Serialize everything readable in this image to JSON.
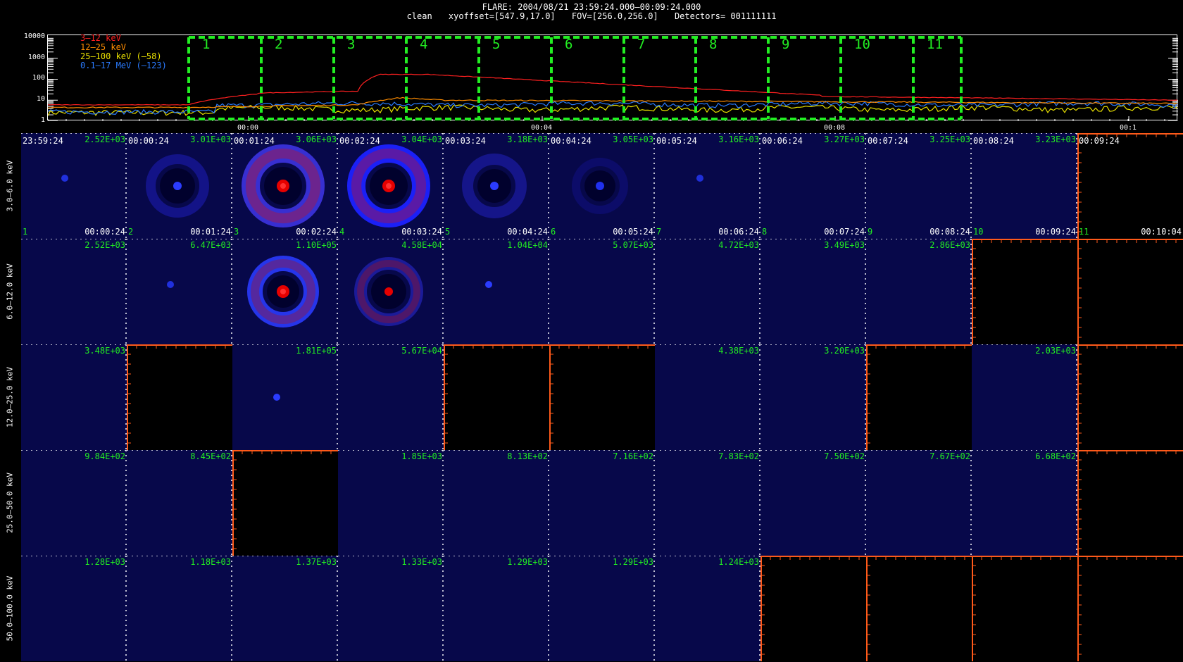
{
  "header": {
    "title": "FLARE: 2004/08/21 23:59:24.000—00:09:24.000",
    "mode": "clean",
    "xyoffset": "xyoffset=[547.9,17.0]",
    "fov": "FOV=[256.0,256.0]",
    "detectors": "Detectors= 001111111"
  },
  "lightcurve": {
    "y_ticks": [
      "10000",
      "1000",
      "100",
      "10",
      "1"
    ],
    "x_ticks": [
      "00:00",
      "00:04",
      "00:08",
      "00:1"
    ],
    "legend": [
      {
        "label": "3—12 keV",
        "color": "#ff2020"
      },
      {
        "label": "12—25 keV",
        "color": "#ff8c00"
      },
      {
        "label": "25—100 keV (—58)",
        "color": "#e8e000"
      },
      {
        "label": "0.1—17 MeV (—123)",
        "color": "#2a7bff"
      }
    ],
    "intervals": [
      "1",
      "2",
      "3",
      "4",
      "5",
      "6",
      "7",
      "8",
      "9",
      "10",
      "11"
    ],
    "interval_color": "#22ee22"
  },
  "rows": [
    {
      "label": "3.0—6.0 keV"
    },
    {
      "label": "6.0—12.0 keV"
    },
    {
      "label": "12.0—25.0 keV"
    },
    {
      "label": "25.0—50.0 keV"
    },
    {
      "label": "50.0—100.0 keV"
    }
  ],
  "columns": [
    {
      "start": "23:59:24",
      "end": "00:00:24",
      "num": "1"
    },
    {
      "start": "00:00:24",
      "end": "00:01:24",
      "num": "2"
    },
    {
      "start": "00:01:24",
      "end": "00:02:24",
      "num": "3"
    },
    {
      "start": "00:02:24",
      "end": "00:03:24",
      "num": "4"
    },
    {
      "start": "00:03:24",
      "end": "00:04:24",
      "num": "5"
    },
    {
      "start": "00:04:24",
      "end": "00:05:24",
      "num": "6"
    },
    {
      "start": "00:05:24",
      "end": "00:06:24",
      "num": "7"
    },
    {
      "start": "00:06:24",
      "end": "00:07:24",
      "num": "8"
    },
    {
      "start": "00:07:24",
      "end": "00:08:24",
      "num": "9"
    },
    {
      "start": "00:08:24",
      "end": "00:09:24",
      "num": "10"
    },
    {
      "start": "00:09:24",
      "end": "00:10:04",
      "num": "11"
    }
  ],
  "peaks": [
    [
      "2.52E+03",
      "3.01E+03",
      "3.06E+03",
      "3.04E+03",
      "3.18E+03",
      "3.05E+03",
      "3.16E+03",
      "3.27E+03",
      "3.25E+03",
      "3.23E+03",
      ""
    ],
    [
      "2.52E+03",
      "6.47E+03",
      "1.10E+05",
      "4.58E+04",
      "1.04E+04",
      "5.07E+03",
      "4.72E+03",
      "3.49E+03",
      "2.86E+03",
      "",
      ""
    ],
    [
      "3.48E+03",
      "",
      "1.81E+05",
      "5.67E+04",
      "",
      "",
      "4.38E+03",
      "3.20E+03",
      "",
      "2.03E+03",
      ""
    ],
    [
      "9.84E+02",
      "8.45E+02",
      "",
      "1.85E+03",
      "8.13E+02",
      "7.16E+02",
      "7.83E+02",
      "7.50E+02",
      "7.67E+02",
      "6.68E+02",
      ""
    ],
    [
      "1.28E+03",
      "1.18E+03",
      "1.37E+03",
      "1.33E+03",
      "1.29E+03",
      "1.29E+03",
      "1.24E+03",
      "",
      "",
      "",
      ""
    ]
  ],
  "blank_axis_ticks": [
    "2",
    "4",
    "6",
    "8",
    "10"
  ],
  "colors": {
    "image_bg": "#07084a",
    "axis_orange": "#ff5a1a",
    "label_green": "#22ee22"
  }
}
